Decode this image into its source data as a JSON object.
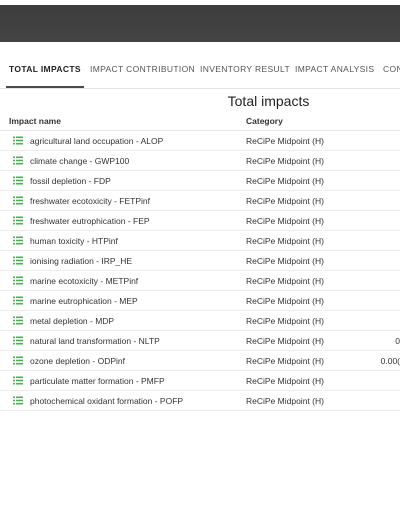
{
  "tabs": [
    {
      "label": "TOTAL IMPACTS",
      "active": true
    },
    {
      "label": "IMPACT CONTRIBUTION",
      "active": false
    },
    {
      "label": "INVENTORY RESULT",
      "active": false
    },
    {
      "label": "IMPACT ANALYSIS",
      "active": false
    },
    {
      "label": "CON",
      "active": false
    }
  ],
  "page_title": "Total impacts",
  "table": {
    "columns": {
      "impact_name": "Impact name",
      "category": "Category"
    },
    "rows": [
      {
        "name": "agricultural land occupation - ALOP",
        "category": "ReCiPe Midpoint (H)",
        "value": ""
      },
      {
        "name": "climate change - GWP100",
        "category": "ReCiPe Midpoint (H)",
        "value": ""
      },
      {
        "name": "fossil depletion - FDP",
        "category": "ReCiPe Midpoint (H)",
        "value": ""
      },
      {
        "name": "freshwater ecotoxicity - FETPinf",
        "category": "ReCiPe Midpoint (H)",
        "value": ""
      },
      {
        "name": "freshwater eutrophication - FEP",
        "category": "ReCiPe Midpoint (H)",
        "value": ""
      },
      {
        "name": "human toxicity - HTPinf",
        "category": "ReCiPe Midpoint (H)",
        "value": ""
      },
      {
        "name": "ionising radiation - IRP_HE",
        "category": "ReCiPe Midpoint (H)",
        "value": ""
      },
      {
        "name": "marine ecotoxicity - METPinf",
        "category": "ReCiPe Midpoint (H)",
        "value": ""
      },
      {
        "name": "marine eutrophication - MEP",
        "category": "ReCiPe Midpoint (H)",
        "value": ""
      },
      {
        "name": "metal depletion - MDP",
        "category": "ReCiPe Midpoint (H)",
        "value": ""
      },
      {
        "name": "natural land transformation - NLTP",
        "category": "ReCiPe Midpoint (H)",
        "value": "0"
      },
      {
        "name": "ozone depletion - ODPinf",
        "category": "ReCiPe Midpoint (H)",
        "value": "0.00("
      },
      {
        "name": "particulate matter formation - PMFP",
        "category": "ReCiPe Midpoint (H)",
        "value": ""
      },
      {
        "name": "photochemical oxidant formation - POFP",
        "category": "ReCiPe Midpoint (H)",
        "value": ""
      }
    ]
  },
  "colors": {
    "topbar": "#424242",
    "icon": "#4caf50"
  },
  "icons": {
    "row_icon": "list-icon"
  }
}
